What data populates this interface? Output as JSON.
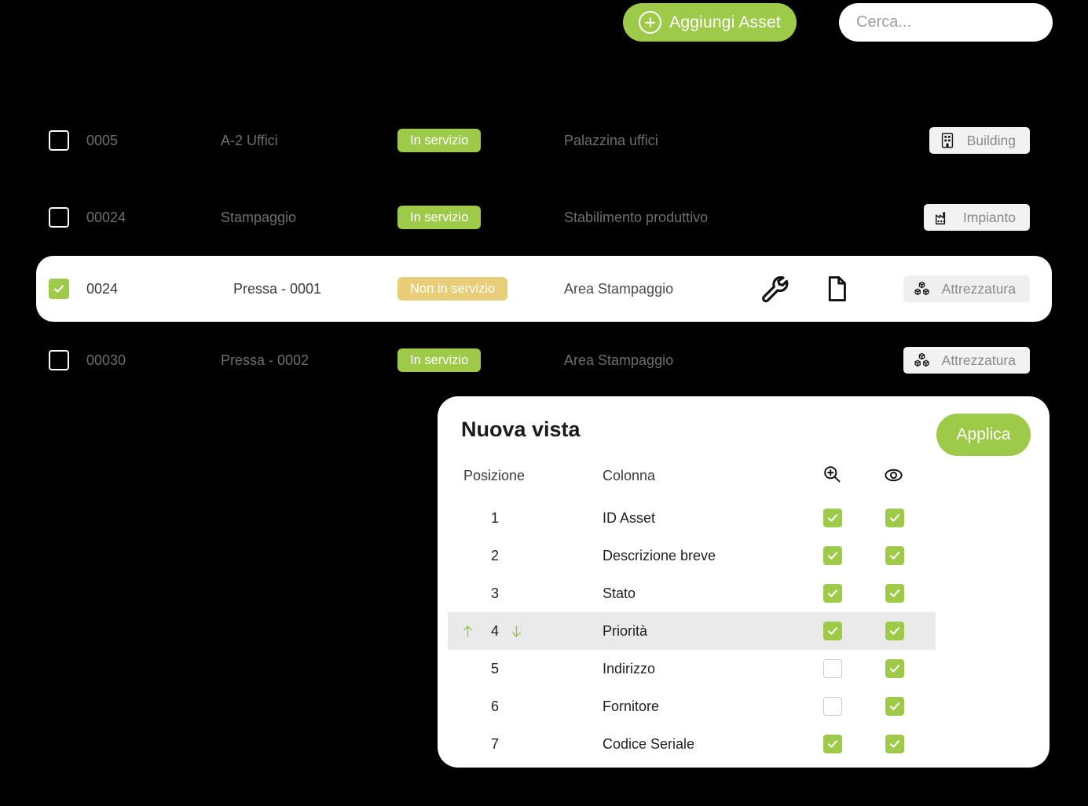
{
  "toolbar": {
    "add_button_label": "Aggiungi Asset",
    "add_icon": "plus-circle-icon",
    "search_placeholder": "Cerca...",
    "search_value": "",
    "search_icon": "search-icon",
    "accent_green": "#9ECA49"
  },
  "asset_table": {
    "rows": [
      {
        "checked": false,
        "selected": false,
        "id": "0005",
        "description": "A-2 Uffici",
        "status": "In servizio",
        "status_kind": "green",
        "location": "Palazzina uffici",
        "type": "Building",
        "type_icon": "building-icon",
        "actions": []
      },
      {
        "checked": false,
        "selected": false,
        "id": "00024",
        "description": "Stampaggio",
        "status": "In servizio",
        "status_kind": "green",
        "location": "Stabilimento produttivo",
        "type": "Impianto",
        "type_icon": "factory-icon",
        "actions": []
      },
      {
        "checked": true,
        "selected": true,
        "id": "0024",
        "description": "Pressa - 0001",
        "status": "Non in servizio",
        "status_kind": "yellow",
        "location": "Area Stampaggio",
        "type": "Attrezzatura",
        "type_icon": "boxes-icon",
        "actions": [
          "wrench-icon",
          "document-icon"
        ]
      },
      {
        "checked": false,
        "selected": false,
        "id": "00030",
        "description": "Pressa - 0002",
        "status": "In servizio",
        "status_kind": "green",
        "location": "Area Stampaggio",
        "type": "Attrezzatura",
        "type_icon": "boxes-icon",
        "actions": []
      }
    ],
    "status_colors": {
      "green": "#9ECA49",
      "yellow": "#E8CE78"
    }
  },
  "view_panel": {
    "title": "Nuova vista",
    "apply_label": "Applica",
    "headers": {
      "position": "Posizione",
      "column": "Colonna",
      "icon_zoom": "zoom-in-icon",
      "icon_visibility": "eye-icon"
    },
    "rows": [
      {
        "position": "1",
        "column": "ID Asset",
        "searchable": true,
        "visible": true,
        "active": false
      },
      {
        "position": "2",
        "column": "Descrizione breve",
        "searchable": true,
        "visible": true,
        "active": false
      },
      {
        "position": "3",
        "column": "Stato",
        "searchable": true,
        "visible": true,
        "active": false
      },
      {
        "position": "4",
        "column": "Priorità",
        "searchable": true,
        "visible": true,
        "active": true
      },
      {
        "position": "5",
        "column": "Indirizzo",
        "searchable": false,
        "visible": true,
        "active": false
      },
      {
        "position": "6",
        "column": "Fornitore",
        "searchable": false,
        "visible": true,
        "active": false
      },
      {
        "position": "7",
        "column": "Codice Seriale",
        "searchable": true,
        "visible": true,
        "active": false
      }
    ],
    "move_up_icon": "arrow-up-icon",
    "move_down_icon": "arrow-down-icon"
  }
}
